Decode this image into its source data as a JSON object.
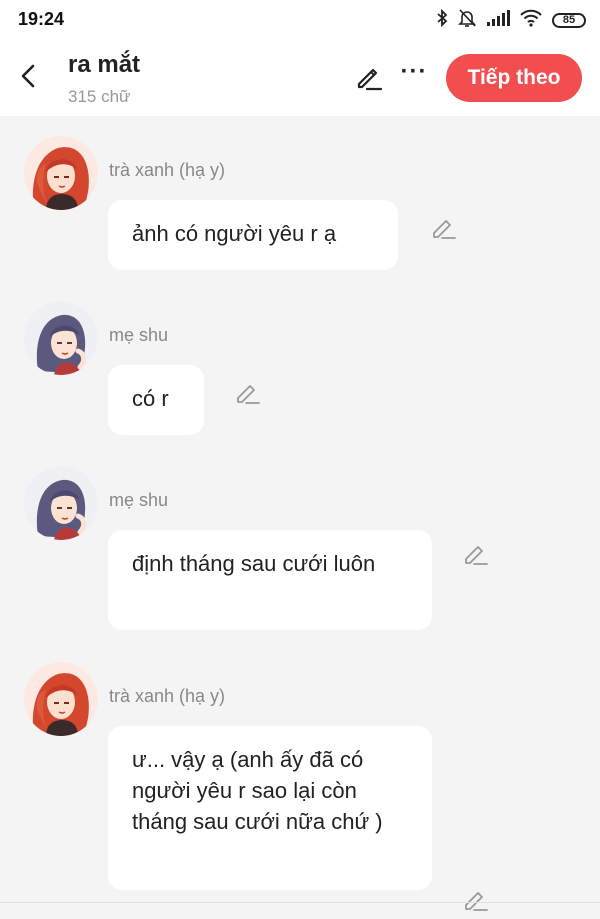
{
  "status_bar": {
    "time": "19:24",
    "battery": "85",
    "icons": [
      "bluetooth-icon",
      "bell-off-icon",
      "signal-icon",
      "wifi-icon",
      "battery-icon"
    ]
  },
  "header": {
    "title": "ra mắt",
    "subtitle": "315 chữ",
    "next_label": "Tiếp theo",
    "more_label": "···"
  },
  "colors": {
    "accent": "#f24d4f",
    "background": "#f4f4f4",
    "bubble": "#ffffff",
    "muted_text": "#888888"
  },
  "messages": [
    {
      "sender": "trà xanh (hạ y)",
      "text": "ảnh có người yêu r ạ",
      "avatar": "red-hair-girl"
    },
    {
      "sender": "mẹ shu",
      "text": "có r",
      "avatar": "purple-hair-woman"
    },
    {
      "sender": "mẹ shu",
      "text": "định tháng sau cưới luôn",
      "avatar": "purple-hair-woman"
    },
    {
      "sender": "trà xanh (hạ y)",
      "text": "ư... vậy ạ (anh ấy đã có người yêu r sao lại còn tháng sau cưới nữa chứ )",
      "avatar": "red-hair-girl"
    }
  ]
}
